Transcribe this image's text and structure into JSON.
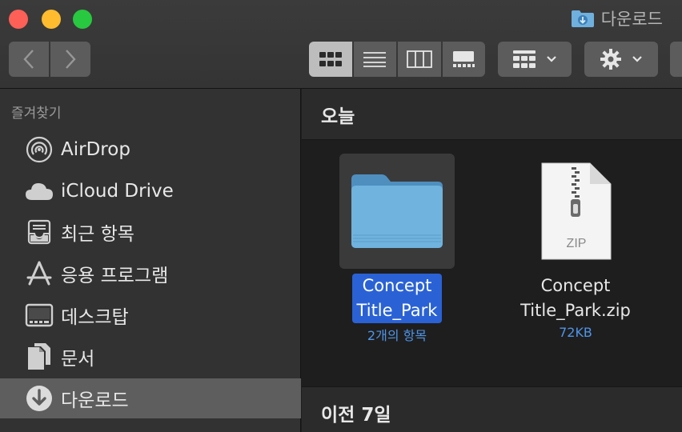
{
  "window": {
    "title": "다운로드"
  },
  "sidebar": {
    "header": "즐겨찾기",
    "items": [
      {
        "label": "AirDrop",
        "icon": "airdrop-icon"
      },
      {
        "label": "iCloud Drive",
        "icon": "cloud-icon"
      },
      {
        "label": "최근 항목",
        "icon": "recents-icon"
      },
      {
        "label": "응용 프로그램",
        "icon": "applications-icon"
      },
      {
        "label": "데스크탑",
        "icon": "desktop-icon"
      },
      {
        "label": "문서",
        "icon": "documents-icon"
      },
      {
        "label": "다운로드",
        "icon": "downloads-icon",
        "selected": true
      }
    ]
  },
  "content": {
    "sections": [
      {
        "label": "오늘"
      },
      {
        "label": "이전 7일"
      }
    ],
    "files": [
      {
        "name_line1": "Concept",
        "name_line2": "Title_Park",
        "meta": "2개의 항목",
        "kind": "folder",
        "selected": true
      },
      {
        "name_line1": "Concept",
        "name_line2": "Title_Park.zip",
        "meta": "72KB",
        "kind": "zip",
        "badge": "ZIP",
        "selected": false
      }
    ]
  },
  "colors": {
    "selection": "#2a62d6",
    "meta_text": "#4f94e8",
    "sidebar_bg": "#323232",
    "content_bg": "#1e1e1e"
  }
}
